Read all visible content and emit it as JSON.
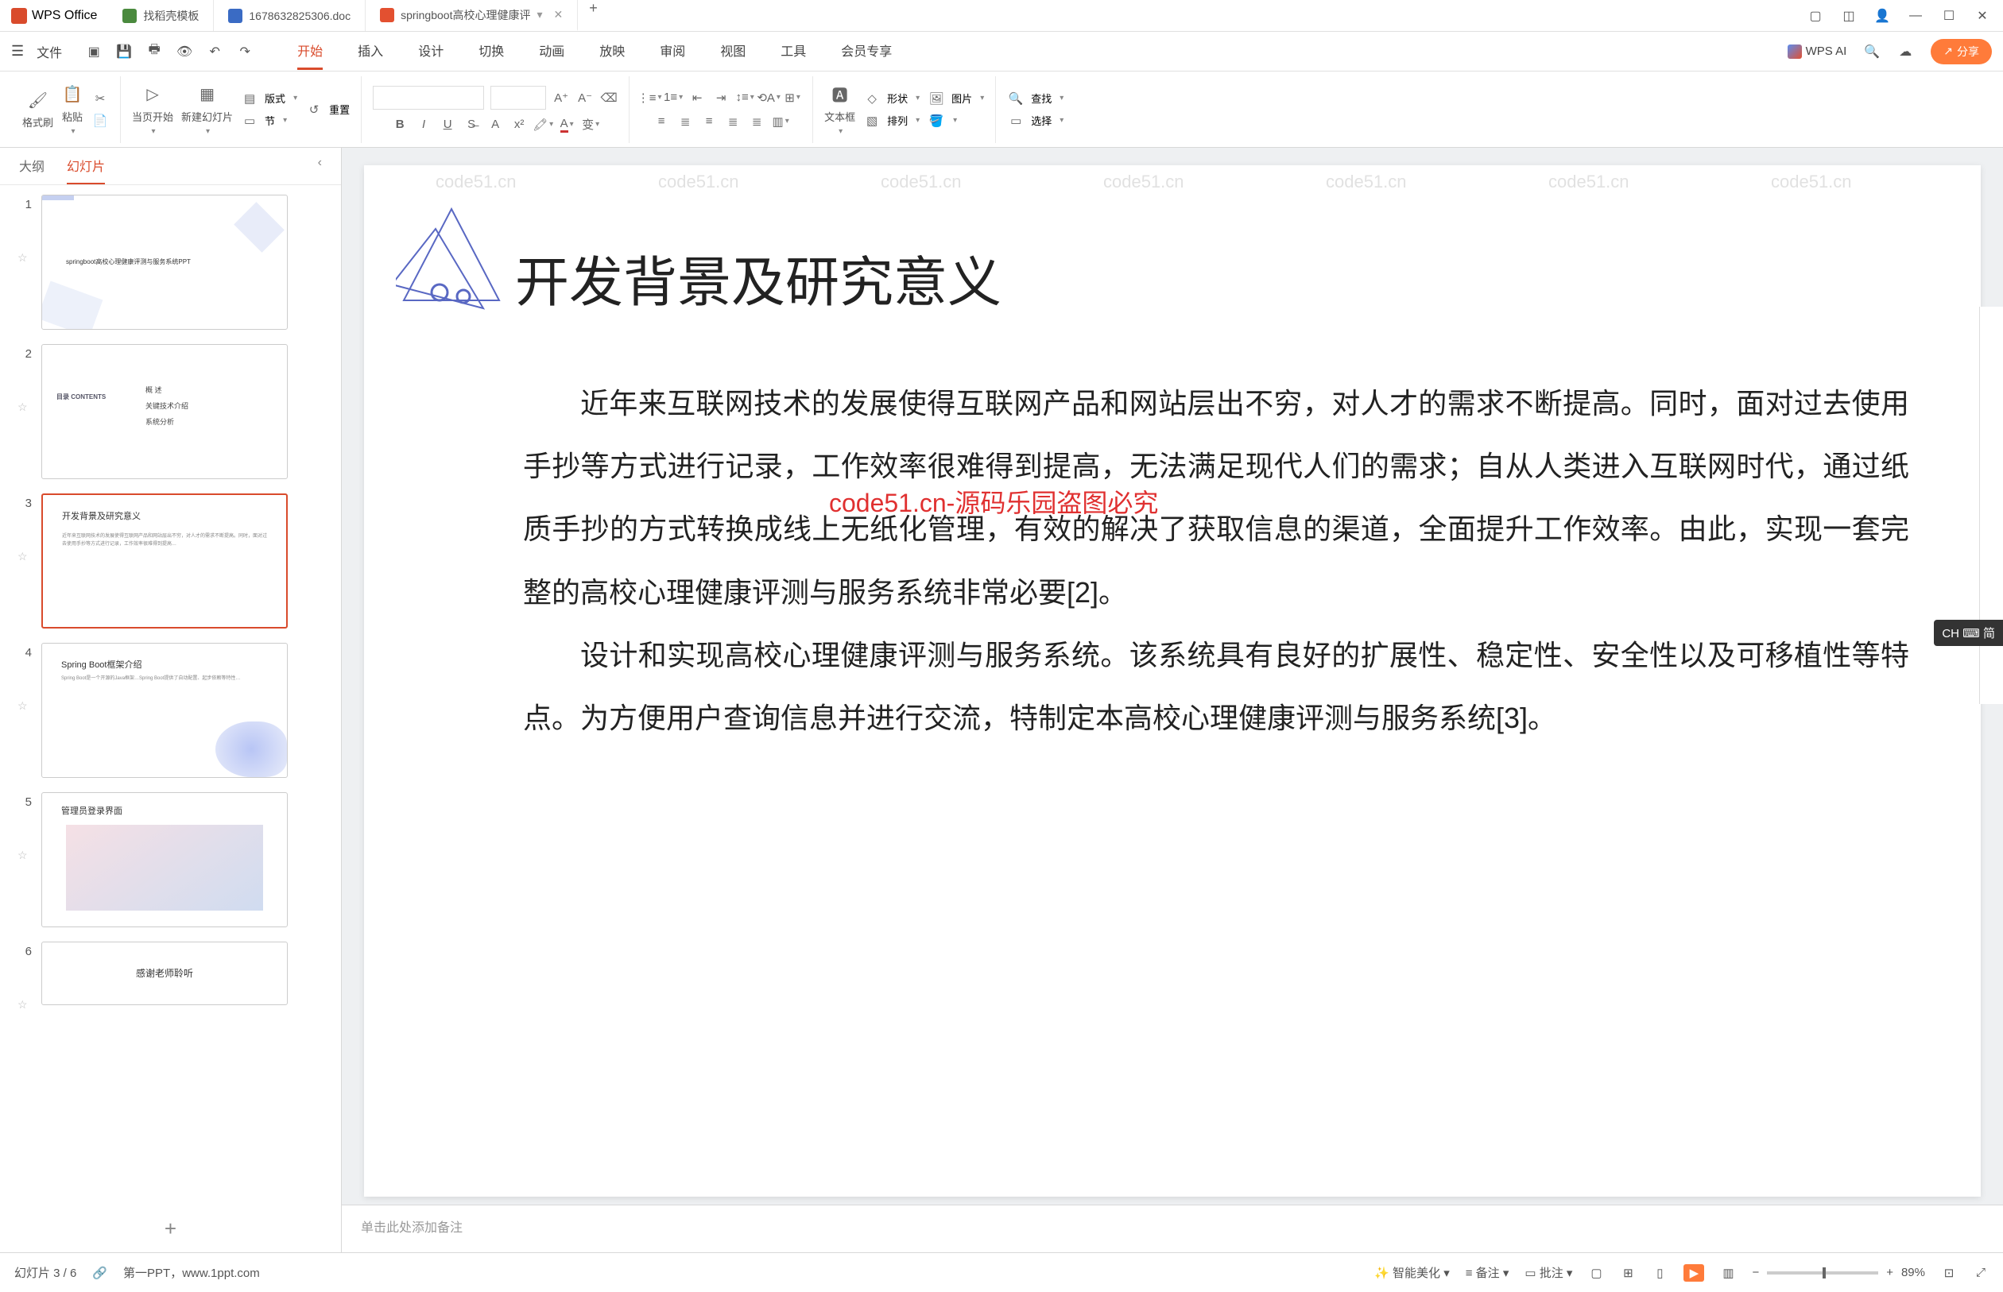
{
  "app": {
    "name": "WPS Office"
  },
  "tabs": [
    {
      "label": "找稻壳模板",
      "icon": "t"
    },
    {
      "label": "1678632825306.doc",
      "icon": "w"
    },
    {
      "label": "springboot高校心理健康评",
      "icon": "p",
      "active": true
    }
  ],
  "menu": {
    "file": "文件",
    "items": [
      "开始",
      "插入",
      "设计",
      "切换",
      "动画",
      "放映",
      "审阅",
      "视图",
      "工具",
      "会员专享"
    ],
    "active": "开始",
    "wps_ai": "WPS AI",
    "share": "分享"
  },
  "ribbon": {
    "format_brush": "格式刷",
    "paste": "粘贴",
    "from_current": "当页开始",
    "new_slide": "新建幻灯片",
    "layout": "版式",
    "section": "节",
    "reset": "重置",
    "textbox": "文本框",
    "shapes": "形状",
    "picture": "图片",
    "arrange": "排列",
    "find": "查找",
    "select": "选择"
  },
  "sidepanel": {
    "outline": "大纲",
    "slides": "幻灯片",
    "thumbs": [
      {
        "n": "1",
        "title": "springboot高校心理健康评测与服务系统PPT"
      },
      {
        "n": "2",
        "title": "目录 CONTENTS",
        "sub1": "概 述",
        "sub2": "关键技术介绍",
        "sub3": "系统分析"
      },
      {
        "n": "3",
        "title": "开发背景及研究意义"
      },
      {
        "n": "4",
        "title": "Spring Boot框架介绍"
      },
      {
        "n": "5",
        "title": "管理员登录界面"
      },
      {
        "n": "6",
        "title": "感谢老师聆听"
      }
    ]
  },
  "slide": {
    "title": "开发背景及研究意义",
    "para1": "近年来互联网技术的发展使得互联网产品和网站层出不穷，对人才的需求不断提高。同时，面对过去使用手抄等方式进行记录，工作效率很难得到提高，无法满足现代人们的需求；自从人类进入互联网时代，通过纸质手抄的方式转换成线上无纸化管理，有效的解决了获取信息的渠道，全面提升工作效率。由此，实现一套完整的高校心理健康评测与服务系统非常必要[2]。",
    "para2": "设计和实现高校心理健康评测与服务系统。该系统具有良好的扩展性、稳定性、安全性以及可移植性等特点。为方便用户查询信息并进行交流，特制定本高校心理健康评测与服务系统[3]。",
    "redmark": "code51.cn-源码乐园盗图必究"
  },
  "notes": {
    "placeholder": "单击此处添加备注"
  },
  "statusbar": {
    "slide_pos": "幻灯片 3 / 6",
    "source": "第一PPT，www.1ppt.com",
    "beautify": "智能美化",
    "notes": "备注",
    "comments": "批注",
    "zoom": "89%"
  },
  "ime": "CH ⌨ 简",
  "watermark": "code51.cn"
}
